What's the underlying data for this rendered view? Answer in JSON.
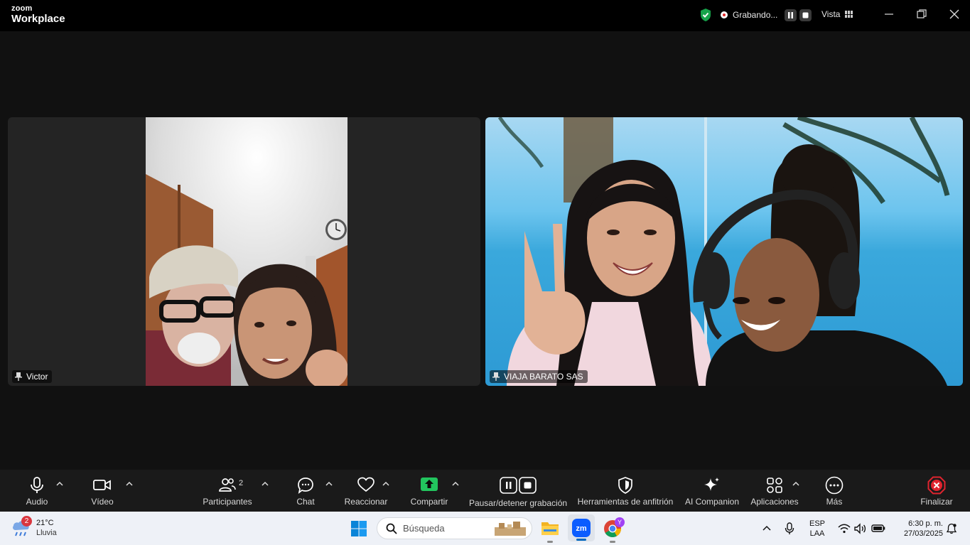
{
  "window": {
    "logo_top": "zoom",
    "logo_bottom": "Workplace",
    "recording_status": "Grabando...",
    "view_label": "Vista"
  },
  "participants": [
    {
      "name": "Victor"
    },
    {
      "name": "VIAJA BARATO SAS"
    }
  ],
  "toolbar": {
    "audio": "Audio",
    "video": "Vídeo",
    "participants": "Participantes",
    "participants_count": "2",
    "chat": "Chat",
    "react": "Reaccionar",
    "share": "Compartir",
    "pause_recording": "Pausar/detener grabación",
    "host_tools": "Herramientas de anfitrión",
    "ai_companion": "AI Companion",
    "apps": "Aplicaciones",
    "more": "Más",
    "end": "Finalizar"
  },
  "taskbar": {
    "weather_badge": "2",
    "temperature": "21°C",
    "weather_condition": "Lluvia",
    "search_placeholder": "Búsqueda",
    "chrome_badge": "Y",
    "lang_top": "ESP",
    "lang_bottom": "LAA",
    "time": "6:30 p. m.",
    "date": "27/03/2025"
  },
  "colors": {
    "share_green": "#22c55e",
    "end_red": "#e0242f",
    "shield_green": "#16a34a",
    "zoom_blue": "#0b5cff"
  }
}
